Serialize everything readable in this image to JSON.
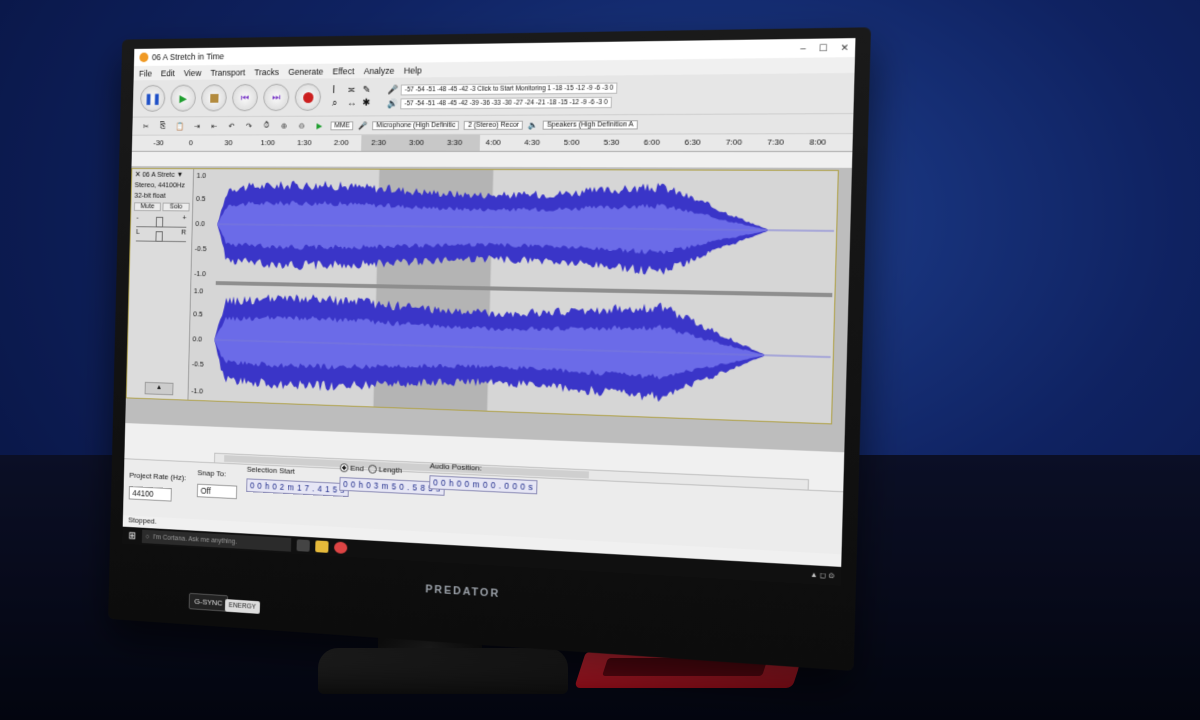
{
  "window": {
    "title": "06 A Stretch in Time"
  },
  "menu": [
    "File",
    "Edit",
    "View",
    "Transport",
    "Tracks",
    "Generate",
    "Effect",
    "Analyze",
    "Help"
  ],
  "meters": {
    "record_scale": "-57 -54 -51 -48 -45 -42 -3 Click to Start Monitoring 1 -18 -15 -12 -9 -6 -3 0",
    "play_scale": "-57 -54 -51 -48 -45 -42 -39 -36 -33 -30 -27 -24 -21 -18 -15 -12 -9 -6 -3 0"
  },
  "devices": {
    "host": "MME",
    "microphone": "Microphone (High Definitic",
    "channels": "2 (Stereo) Recor",
    "speakers": "Speakers (High Definition A"
  },
  "timeline": {
    "ticks": [
      "-30",
      "0",
      "30",
      "1:00",
      "1:30",
      "2:00",
      "2:30",
      "3:00",
      "3:30",
      "4:00",
      "4:30",
      "5:00",
      "5:30",
      "6:00",
      "6:30",
      "7:00",
      "7:30",
      "8:00"
    ]
  },
  "track": {
    "name": "06 A Stretc",
    "info1": "Stereo, 44100Hz",
    "info2": "32-bit float",
    "mute": "Mute",
    "solo": "Solo",
    "gain_minus": "-",
    "gain_plus": "+",
    "pan_l": "L",
    "pan_r": "R",
    "scale": [
      "1.0",
      "0.5",
      "0.0",
      "-0.5",
      "-1.0"
    ],
    "waveform_color": "#3a35c8",
    "waveform_rms_color": "#6b6be8"
  },
  "selection": {
    "start_minutes": 2.29,
    "end_minutes": 3.85
  },
  "bottom": {
    "project_rate_label": "Project Rate (Hz):",
    "project_rate_value": "44100",
    "snap_to_label": "Snap To:",
    "snap_to_value": "Off",
    "selection_start_label": "Selection Start",
    "selection_start_value": "0 0 h 0 2 m 1 7 . 4 1 5 s",
    "end_label": "End",
    "length_label": "Length",
    "end_value": "0 0 h 0 3 m 5 0 . 5 8 5 s",
    "audio_position_label": "Audio Position:",
    "audio_position_value": "0 0 h 0 0 m 0 0 . 0 0 0 s"
  },
  "status": "Stopped.",
  "taskbar": {
    "cortana": "I'm Cortana. Ask me anything."
  },
  "monitor": {
    "brand": "PREDATOR",
    "badge1": "G-SYNC",
    "badge2": "ENERGY"
  }
}
